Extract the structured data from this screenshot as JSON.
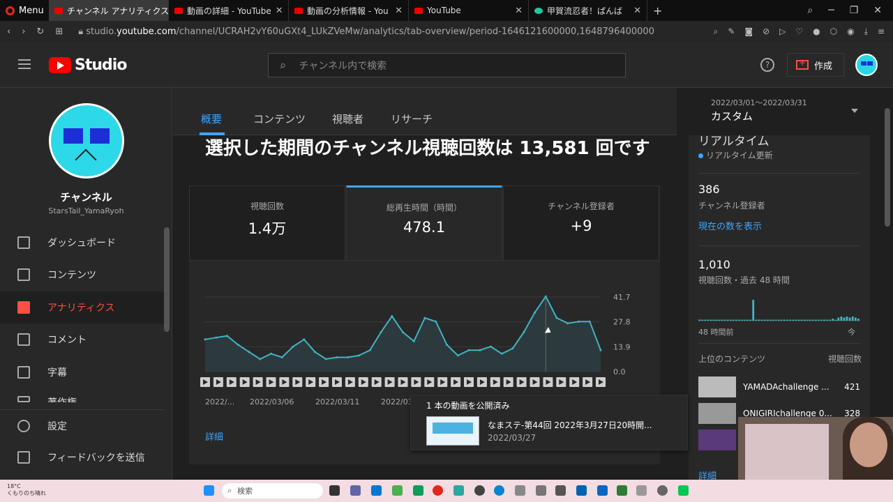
{
  "browser": {
    "menu_label": "Menu",
    "tabs": [
      {
        "label": "チャンネル アナリティクス"
      },
      {
        "label": "動画の詳細 - YouTube"
      },
      {
        "label": "動画の分析情報 - You"
      },
      {
        "label": "YouTube"
      },
      {
        "label": "甲賀流忍者！ぱんば"
      }
    ],
    "url_prefix": "studio.",
    "url_domain": "youtube.com",
    "url_path": "/channel/UCRAH2vY60uGXt4_LUkZVeMw/analytics/tab-overview/period-1646121600000,1648796400000"
  },
  "header": {
    "logo_text": "Studio",
    "search_placeholder": "チャンネル内で検索",
    "create_label": "作成"
  },
  "sidebar": {
    "channel_name": "チャンネル",
    "channel_handle": "StarsTail_YamaRyoh",
    "items": [
      {
        "label": "ダッシュボード"
      },
      {
        "label": "コンテンツ"
      },
      {
        "label": "アナリティクス"
      },
      {
        "label": "コメント"
      },
      {
        "label": "字幕"
      },
      {
        "label": "著作権"
      },
      {
        "label": "設定"
      },
      {
        "label": "フィードバックを送信"
      }
    ]
  },
  "main": {
    "tabs": [
      "概要",
      "コンテンツ",
      "視聴者",
      "リサーチ"
    ],
    "headline": "選択した期間のチャンネル視聴回数は 13,581 回です",
    "metrics": [
      {
        "label": "視聴回数",
        "value": "1.4万"
      },
      {
        "label": "総再生時間（時間）",
        "value": "478.1"
      },
      {
        "label": "チャンネル登録者",
        "value": "+9"
      }
    ],
    "details_link": "詳細",
    "date_range": "2022/03/01～2022/03/31",
    "range_type": "カスタム"
  },
  "chart_data": {
    "type": "area",
    "series": [
      {
        "values": [
          18,
          19,
          20,
          15,
          11,
          7,
          10,
          8,
          14,
          18,
          11,
          7,
          8,
          8,
          9,
          12,
          22,
          31,
          22,
          17,
          30,
          28,
          15,
          9,
          12,
          12,
          14,
          10,
          13,
          22,
          33,
          42,
          30,
          27,
          28,
          28,
          12
        ]
      }
    ],
    "x_tick_labels": [
      "2022/...",
      "2022/03/06",
      "2022/03/11",
      "2022/03..."
    ],
    "y_tick_labels": [
      "41.7",
      "27.8",
      "13.9",
      "0.0"
    ],
    "ylim": [
      0,
      41.7
    ],
    "grid": true
  },
  "tooltip": {
    "title": "1 本の動画を公開済み",
    "video_title": "なまステ-第44回 2022年3月27日20時開...",
    "date": "2022/03/27"
  },
  "realtime": {
    "title": "リアルタイム",
    "subtitle": "リアルタイム更新",
    "subs_count": "386",
    "subs_label": "チャンネル登録者",
    "show_count_link": "現在の数を表示",
    "views_count": "1,010",
    "views_label": "視聴回数・過去 48 時間",
    "bar_values": [
      1,
      1,
      1,
      1,
      1,
      1,
      1,
      1,
      1,
      1,
      1,
      1,
      1,
      1,
      1,
      1,
      1,
      1,
      1,
      20,
      1,
      1,
      1,
      1,
      1,
      1,
      1,
      1,
      1,
      1,
      1,
      1,
      1,
      1,
      1,
      1,
      1,
      1,
      1,
      1,
      1,
      1,
      1,
      1,
      1,
      1,
      1,
      2,
      1,
      3,
      4,
      3,
      4,
      3,
      4,
      3,
      2
    ],
    "axis_left": "48 時間前",
    "axis_right": "今",
    "top_content_label": "上位のコンテンツ",
    "top_views_label": "視聴回数",
    "top_items": [
      {
        "title": "YAMADAchallenge ...",
        "views": "421"
      },
      {
        "title": "ONIGIRIchallenge 0...",
        "views": "328"
      },
      {
        "title": "",
        "views": ""
      }
    ],
    "details_link": "詳細"
  },
  "taskbar": {
    "temp": "18°C",
    "weather": "くもりのち晴れ",
    "search_label": "検索"
  },
  "colors": {
    "accent": "#3ea6ff",
    "brand": "#ff0000",
    "active_nav": "#ff4e45",
    "chart_line": "#41b4c2"
  }
}
